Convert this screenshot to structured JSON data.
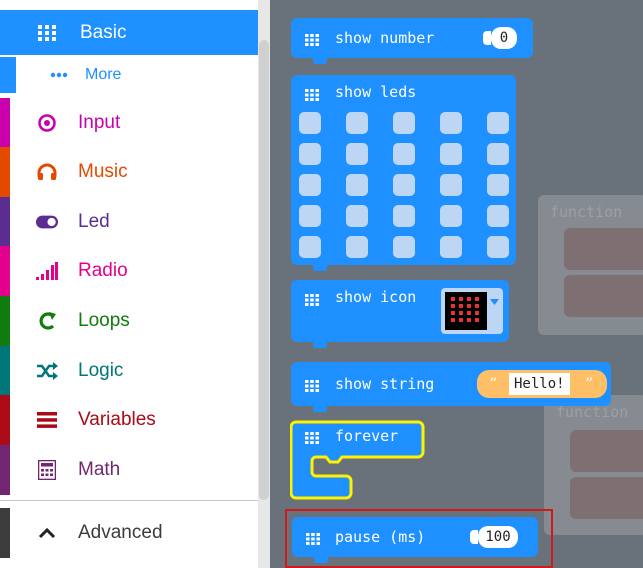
{
  "toolbox": {
    "categories": [
      {
        "label": "Basic",
        "icon": "grid-icon",
        "color": "#1e90ff",
        "selected": true
      },
      {
        "label": "More",
        "icon": "ellipsis-icon",
        "color": "#1e90ff"
      },
      {
        "label": "Input",
        "icon": "target-icon",
        "color": "#c900ac"
      },
      {
        "label": "Music",
        "icon": "headphones-icon",
        "color": "#e34a00"
      },
      {
        "label": "Led",
        "icon": "toggle-icon",
        "color": "#5c2d91"
      },
      {
        "label": "Radio",
        "icon": "signal-bars-icon",
        "color": "#e3008c"
      },
      {
        "label": "Loops",
        "icon": "loop-icon",
        "color": "#107c10"
      },
      {
        "label": "Logic",
        "icon": "shuffle-icon",
        "color": "#00767a"
      },
      {
        "label": "Variables",
        "icon": "list-icon",
        "color": "#ab0a16"
      },
      {
        "label": "Math",
        "icon": "calculator-icon",
        "color": "#712672"
      },
      {
        "label": "Advanced",
        "icon": "chevron-up-icon",
        "color": "#3c3c3c"
      }
    ]
  },
  "workspace": {
    "blocks": {
      "show_number": {
        "label": "show number",
        "value": "0"
      },
      "show_leds": {
        "label": "show leds"
      },
      "show_icon": {
        "label": "show icon"
      },
      "show_string": {
        "label": "show string",
        "open_quote": "“",
        "value": "Hello!",
        "close_quote": "”"
      },
      "forever": {
        "label": "forever"
      },
      "pause": {
        "label": "pause (ms)",
        "value": "100"
      }
    },
    "ghost": {
      "label_1": "function",
      "label_2": "function"
    }
  }
}
